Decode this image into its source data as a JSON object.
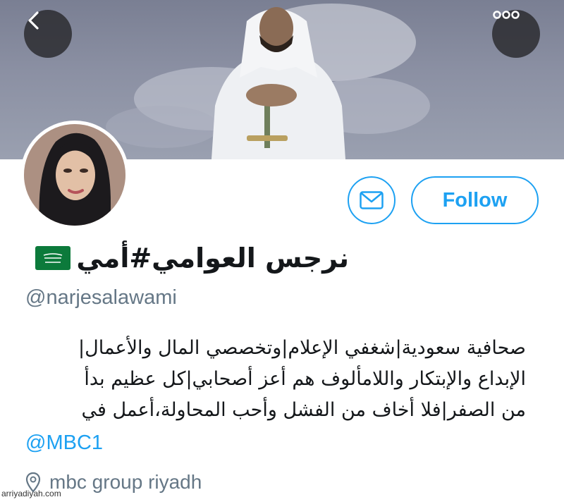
{
  "header": {
    "back_icon": "chevron-left-icon",
    "more_icon": "more-dots-icon"
  },
  "profile": {
    "display_name": "نرجس العوامي#أمي",
    "flag_icon": "saudi-flag-icon",
    "handle": "@narjesalawami",
    "follow_label": "Follow",
    "message_icon": "envelope-icon"
  },
  "bio": {
    "lines": [
      "صحافية سعودية|شغفي الإعلام|وتخصصي المال والأعمال|",
      "الإبداع والإبتكار واللامألوف هم أعز أصحابي|كل عظيم بدأ",
      "من الصفر|فلا أخاف من الفشل وأحب المحاولة،أعمل في"
    ],
    "mention": "@MBC1"
  },
  "location": {
    "icon": "location-pin-icon",
    "text": "mbc group riyadh"
  },
  "watermark": "arriyadiyah.com",
  "colors": {
    "accent": "#1da1f2",
    "secondary_text": "#657786",
    "primary_text": "#14171a"
  }
}
